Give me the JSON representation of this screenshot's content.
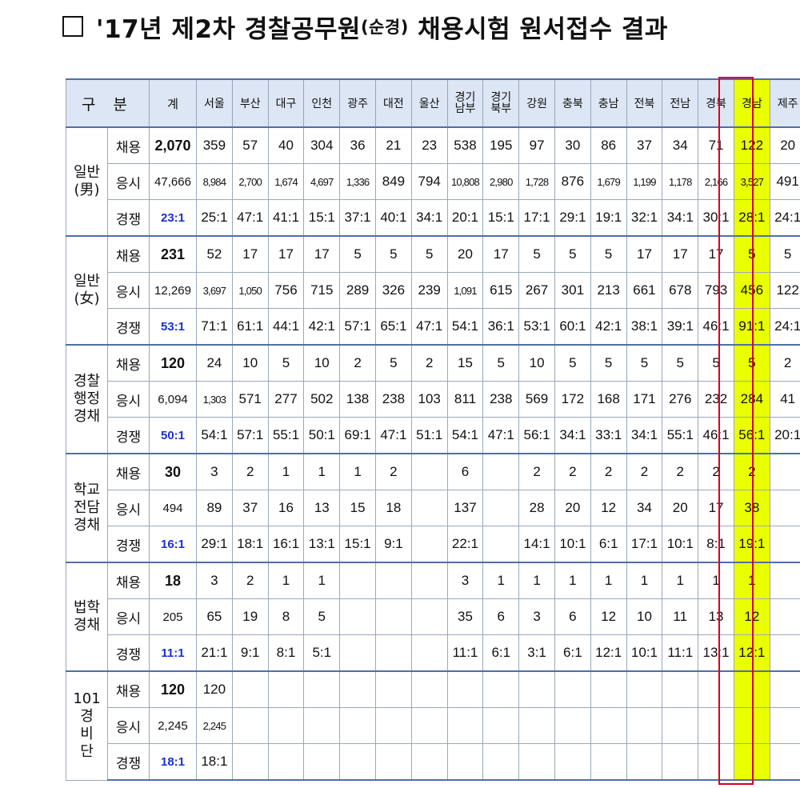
{
  "title": {
    "main": "'17년 제2차 경찰공무원",
    "sub": "(순경)",
    "rest": " 채용시험 원서접수 결과"
  },
  "header": {
    "gubun": "구 분",
    "total": "계",
    "regions": [
      "서울",
      "부산",
      "대구",
      "인천",
      "광주",
      "대전",
      "울산",
      "경기\n남부",
      "경기\n북부",
      "강원",
      "충북",
      "충남",
      "전북",
      "전남",
      "경북",
      "경남",
      "제주"
    ]
  },
  "highlight": {
    "region": "경남",
    "fill_color": "#eaff00",
    "border_color": "#d9001b"
  },
  "groups": [
    {
      "name": "일반\n(男)",
      "rows": [
        {
          "metric": "채용",
          "total": "2,070",
          "values": [
            "359",
            "57",
            "40",
            "304",
            "36",
            "21",
            "23",
            "538",
            "195",
            "97",
            "30",
            "86",
            "37",
            "34",
            "71",
            "122",
            "20"
          ]
        },
        {
          "metric": "응시",
          "total": "47,666",
          "values": [
            "8,984",
            "2,700",
            "1,674",
            "4,697",
            "1,336",
            "849",
            "794",
            "10,808",
            "2,980",
            "1,728",
            "876",
            "1,679",
            "1,199",
            "1,178",
            "2,166",
            "3,527",
            "491"
          ]
        },
        {
          "metric": "경쟁",
          "total": "23:1",
          "values": [
            "25:1",
            "47:1",
            "41:1",
            "15:1",
            "37:1",
            "40:1",
            "34:1",
            "20:1",
            "15:1",
            "17:1",
            "29:1",
            "19:1",
            "32:1",
            "34:1",
            "30:1",
            "28:1",
            "24:1"
          ]
        }
      ]
    },
    {
      "name": "일반\n(女)",
      "rows": [
        {
          "metric": "채용",
          "total": "231",
          "values": [
            "52",
            "17",
            "17",
            "17",
            "5",
            "5",
            "5",
            "20",
            "17",
            "5",
            "5",
            "5",
            "17",
            "17",
            "17",
            "5",
            "5"
          ]
        },
        {
          "metric": "응시",
          "total": "12,269",
          "values": [
            "3,697",
            "1,050",
            "756",
            "715",
            "289",
            "326",
            "239",
            "1,091",
            "615",
            "267",
            "301",
            "213",
            "661",
            "678",
            "793",
            "456",
            "122"
          ]
        },
        {
          "metric": "경쟁",
          "total": "53:1",
          "values": [
            "71:1",
            "61:1",
            "44:1",
            "42:1",
            "57:1",
            "65:1",
            "47:1",
            "54:1",
            "36:1",
            "53:1",
            "60:1",
            "42:1",
            "38:1",
            "39:1",
            "46:1",
            "91:1",
            "24:1"
          ]
        }
      ]
    },
    {
      "name": "경찰\n행정\n경채",
      "rows": [
        {
          "metric": "채용",
          "total": "120",
          "values": [
            "24",
            "10",
            "5",
            "10",
            "2",
            "5",
            "2",
            "15",
            "5",
            "10",
            "5",
            "5",
            "5",
            "5",
            "5",
            "5",
            "2"
          ]
        },
        {
          "metric": "응시",
          "total": "6,094",
          "values": [
            "1,303",
            "571",
            "277",
            "502",
            "138",
            "238",
            "103",
            "811",
            "238",
            "569",
            "172",
            "168",
            "171",
            "276",
            "232",
            "284",
            "41"
          ]
        },
        {
          "metric": "경쟁",
          "total": "50:1",
          "values": [
            "54:1",
            "57:1",
            "55:1",
            "50:1",
            "69:1",
            "47:1",
            "51:1",
            "54:1",
            "47:1",
            "56:1",
            "34:1",
            "33:1",
            "34:1",
            "55:1",
            "46:1",
            "56:1",
            "20:1"
          ]
        }
      ]
    },
    {
      "name": "학교\n전담\n경채",
      "rows": [
        {
          "metric": "채용",
          "total": "30",
          "values": [
            "3",
            "2",
            "1",
            "1",
            "1",
            "2",
            "",
            "6",
            "",
            "2",
            "2",
            "2",
            "2",
            "2",
            "2",
            "2",
            ""
          ]
        },
        {
          "metric": "응시",
          "total": "494",
          "values": [
            "89",
            "37",
            "16",
            "13",
            "15",
            "18",
            "",
            "137",
            "",
            "28",
            "20",
            "12",
            "34",
            "20",
            "17",
            "38",
            ""
          ]
        },
        {
          "metric": "경쟁",
          "total": "16:1",
          "values": [
            "29:1",
            "18:1",
            "16:1",
            "13:1",
            "15:1",
            "9:1",
            "",
            "22:1",
            "",
            "14:1",
            "10:1",
            "6:1",
            "17:1",
            "10:1",
            "8:1",
            "19:1",
            ""
          ]
        }
      ]
    },
    {
      "name": "법학\n경채",
      "rows": [
        {
          "metric": "채용",
          "total": "18",
          "values": [
            "3",
            "2",
            "1",
            "1",
            "",
            "",
            "",
            "3",
            "1",
            "1",
            "1",
            "1",
            "1",
            "1",
            "1",
            "1",
            ""
          ]
        },
        {
          "metric": "응시",
          "total": "205",
          "values": [
            "65",
            "19",
            "8",
            "5",
            "",
            "",
            "",
            "35",
            "6",
            "3",
            "6",
            "12",
            "10",
            "11",
            "13",
            "12",
            ""
          ]
        },
        {
          "metric": "경쟁",
          "total": "11:1",
          "values": [
            "21:1",
            "9:1",
            "8:1",
            "5:1",
            "",
            "",
            "",
            "11:1",
            "6:1",
            "3:1",
            "6:1",
            "12:1",
            "10:1",
            "11:1",
            "13:1",
            "12:1",
            ""
          ]
        }
      ]
    },
    {
      "name": "101\n경\n비\n단",
      "rows": [
        {
          "metric": "채용",
          "total": "120",
          "values": [
            "120",
            "",
            "",
            "",
            "",
            "",
            "",
            "",
            "",
            "",
            "",
            "",
            "",
            "",
            "",
            "",
            ""
          ]
        },
        {
          "metric": "응시",
          "total": "2,245",
          "values": [
            "2,245",
            "",
            "",
            "",
            "",
            "",
            "",
            "",
            "",
            "",
            "",
            "",
            "",
            "",
            "",
            "",
            ""
          ]
        },
        {
          "metric": "경쟁",
          "total": "18:1",
          "values": [
            "18:1",
            "",
            "",
            "",
            "",
            "",
            "",
            "",
            "",
            "",
            "",
            "",
            "",
            "",
            "",
            "",
            ""
          ]
        }
      ]
    }
  ]
}
